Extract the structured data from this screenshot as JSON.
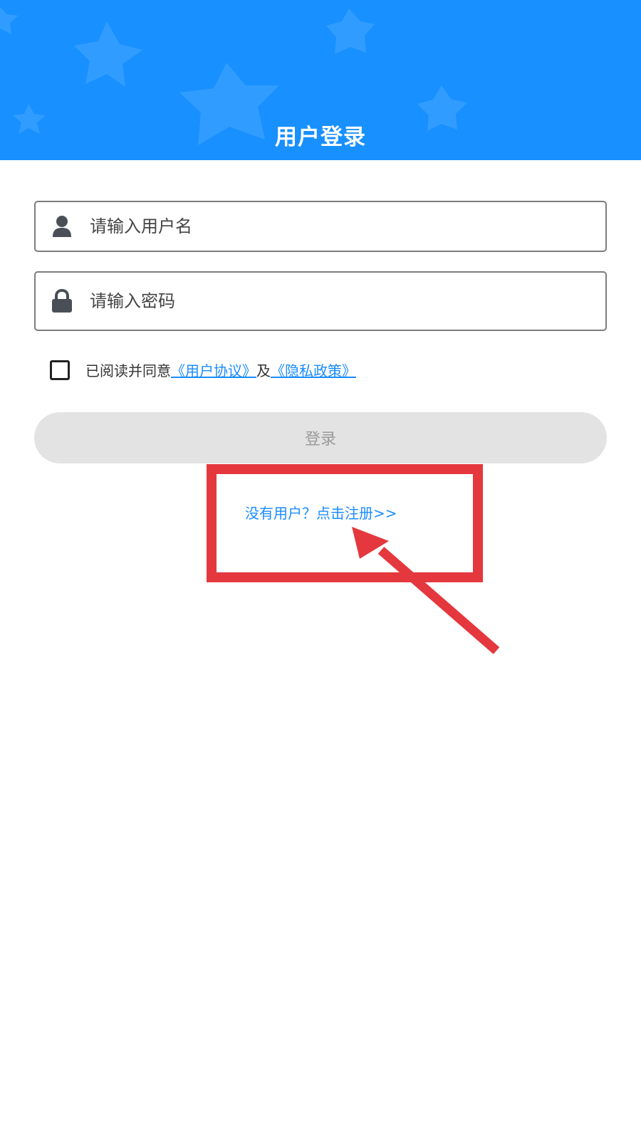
{
  "header": {
    "title": "用户登录",
    "background_color": "#1890ff"
  },
  "form": {
    "username": {
      "placeholder": "请输入用户名",
      "value": "",
      "icon": "user-icon"
    },
    "password": {
      "placeholder": "请输入密码",
      "value": "",
      "icon": "lock-icon"
    },
    "agreement": {
      "checked": false,
      "prefix": "已阅读并同意",
      "user_agreement_link": "《用户协议》",
      "conjunction": "及",
      "privacy_policy_link": "《隐私政策》"
    },
    "login_button_label": "登录"
  },
  "register_link": "没有用户？点击注册>>",
  "annotation": {
    "highlight_color": "#e4383e"
  },
  "colors": {
    "accent": "#1a8cff",
    "button_disabled_bg": "#e3e3e3",
    "button_disabled_text": "#9a9a9a"
  }
}
